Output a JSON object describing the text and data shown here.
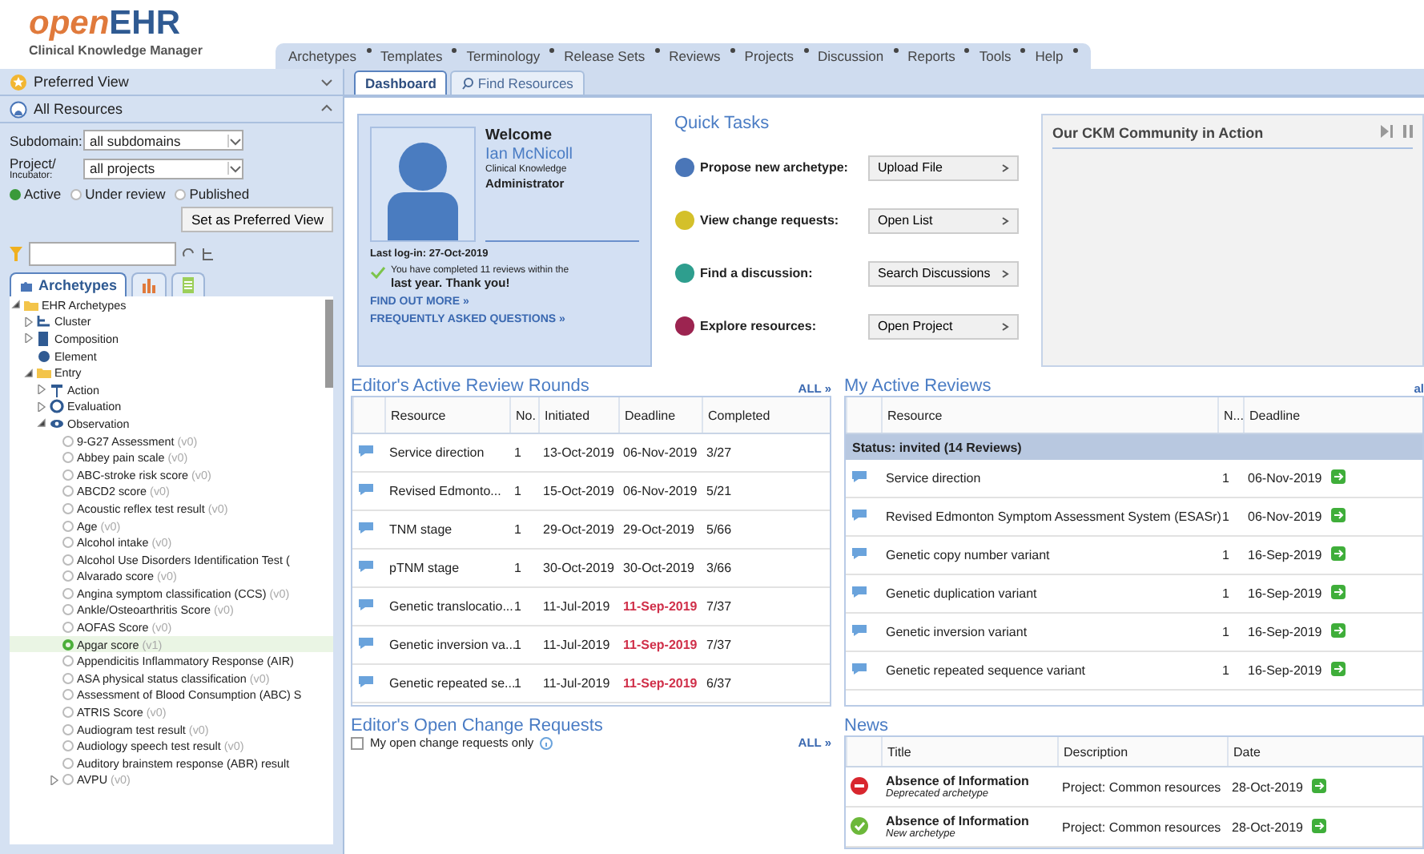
{
  "logo": {
    "brand_light": "open",
    "brand_bold": "EHR",
    "subtitle": "Clinical Knowledge Manager"
  },
  "menu": [
    {
      "label": "Archetypes"
    },
    {
      "label": "Templates"
    },
    {
      "label": "Terminology"
    },
    {
      "label": "Release Sets"
    },
    {
      "label": "Reviews"
    },
    {
      "label": "Projects"
    },
    {
      "label": "Discussion"
    },
    {
      "label": "Reports"
    },
    {
      "label": "Tools"
    },
    {
      "label": "Help"
    }
  ],
  "sidebar": {
    "preferred_view": {
      "title": "Preferred View",
      "expanded": false
    },
    "all_resources": {
      "title": "All Resources",
      "expanded": true
    },
    "subdomain": {
      "label": "Subdomain:",
      "value": "all subdomains"
    },
    "project": {
      "label": "Project/",
      "sublabel": "Incubator:",
      "value": "all projects"
    },
    "status_filter": [
      {
        "label": "Active",
        "selected": true
      },
      {
        "label": "Under review",
        "selected": false
      },
      {
        "label": "Published",
        "selected": false
      }
    ],
    "preferred_button": "Set as Preferred View",
    "tabs": [
      {
        "kind": "archetypes",
        "label": "Archetypes",
        "selected": true
      },
      {
        "kind": "templates",
        "selected": false
      },
      {
        "kind": "terminology",
        "selected": false
      }
    ],
    "tree": [
      {
        "label": "EHR Archetypes",
        "kind": "folder",
        "expanded": true,
        "children": [
          {
            "label": "Cluster",
            "kind": "cluster",
            "expanded": false
          },
          {
            "label": "Composition",
            "kind": "composition",
            "expanded": false
          },
          {
            "label": "Element",
            "kind": "element"
          },
          {
            "label": "Entry",
            "kind": "folder",
            "expanded": true,
            "children": [
              {
                "label": "Action",
                "kind": "action",
                "expanded": false
              },
              {
                "label": "Evaluation",
                "kind": "evaluation",
                "expanded": false
              },
              {
                "label": "Observation",
                "kind": "observation",
                "expanded": true,
                "children": [
                  {
                    "label": "9-G27 Assessment",
                    "version": "(v0)",
                    "kind": "archetype",
                    "selected": false
                  },
                  {
                    "label": "Abbey pain scale",
                    "version": "(v0)",
                    "kind": "archetype",
                    "selected": false
                  },
                  {
                    "label": "ABC-stroke risk score",
                    "version": "(v0)",
                    "kind": "archetype",
                    "selected": false
                  },
                  {
                    "label": "ABCD2 score",
                    "version": "(v0)",
                    "kind": "archetype",
                    "selected": false
                  },
                  {
                    "label": "Acoustic reflex test result",
                    "version": "(v0)",
                    "kind": "archetype",
                    "selected": false
                  },
                  {
                    "label": "Age",
                    "version": "(v0)",
                    "kind": "archetype",
                    "selected": false
                  },
                  {
                    "label": "Alcohol intake",
                    "version": "(v0)",
                    "kind": "archetype",
                    "selected": false
                  },
                  {
                    "label": "Alcohol Use Disorders Identification Test (",
                    "kind": "archetype",
                    "selected": false
                  },
                  {
                    "label": "Alvarado score",
                    "version": "(v0)",
                    "kind": "archetype",
                    "selected": false
                  },
                  {
                    "label": "Angina symptom classification (CCS)",
                    "version": "(v0)",
                    "kind": "archetype",
                    "selected": false
                  },
                  {
                    "label": "Ankle/Osteoarthritis Score",
                    "version": "(v0)",
                    "kind": "archetype",
                    "selected": false
                  },
                  {
                    "label": "AOFAS Score",
                    "version": "(v0)",
                    "kind": "archetype",
                    "selected": false
                  },
                  {
                    "label": "Apgar score",
                    "version": "(v1)",
                    "kind": "archetype",
                    "selected": true
                  },
                  {
                    "label": "Appendicitis Inflammatory Response (AIR)",
                    "kind": "archetype",
                    "selected": false
                  },
                  {
                    "label": "ASA physical status classification",
                    "version": "(v0)",
                    "kind": "archetype",
                    "selected": false
                  },
                  {
                    "label": "Assessment of Blood Consumption (ABC) S",
                    "kind": "archetype",
                    "selected": false
                  },
                  {
                    "label": "ATRIS Score",
                    "version": "(v0)",
                    "kind": "archetype",
                    "selected": false
                  },
                  {
                    "label": "Audiogram test result",
                    "version": "(v0)",
                    "kind": "archetype",
                    "selected": false
                  },
                  {
                    "label": "Audiology speech test result",
                    "version": "(v0)",
                    "kind": "archetype",
                    "selected": false
                  },
                  {
                    "label": "Auditory brainstem response (ABR) result",
                    "kind": "archetype",
                    "selected": false
                  },
                  {
                    "label": "AVPU",
                    "version": "(v0)",
                    "kind": "archetype",
                    "selected": false,
                    "expanded": false
                  }
                ]
              }
            ]
          }
        ]
      }
    ]
  },
  "main_tabs": [
    {
      "label": "Dashboard",
      "kind": "plain",
      "selected": true
    },
    {
      "label": "Find Resources",
      "kind": "search",
      "selected": false
    }
  ],
  "welcome": {
    "greeting": "Welcome",
    "name": "Ian McNicoll",
    "role_small": "Clinical Knowledge",
    "role": "Administrator",
    "last_login": "Last log-in: 27-Oct-2019",
    "message_small": "You have completed 11 reviews within the",
    "message": "last year. Thank you!",
    "links": [
      "FIND OUT MORE »",
      "FREQUENTLY ASKED QUESTIONS »"
    ]
  },
  "quick_tasks": {
    "title": "Quick Tasks",
    "items": [
      {
        "label": "Propose new archetype:",
        "button": "Upload File",
        "color": "#4a76b8"
      },
      {
        "label": "View change requests:",
        "button": "Open List",
        "color": "#d4c02a"
      },
      {
        "label": "Find a discussion:",
        "button": "Search Discussions",
        "color": "#2e9e8e"
      },
      {
        "label": "Explore resources:",
        "button": "Open Project",
        "color": "#9c2450"
      }
    ]
  },
  "community": {
    "title": "Our CKM Community in Action"
  },
  "review_rounds": {
    "title": "Editor's Active Review Rounds",
    "all_link": "ALL »",
    "columns": [
      "Resource",
      "No.",
      "Initiated",
      "Deadline",
      "Completed"
    ],
    "rows": [
      {
        "resource": "Service direction",
        "no": "1",
        "initiated": "13-Oct-2019",
        "deadline": "06-Nov-2019",
        "overdue": false,
        "completed": "3/27"
      },
      {
        "resource": "Revised Edmonto...",
        "no": "1",
        "initiated": "15-Oct-2019",
        "deadline": "06-Nov-2019",
        "overdue": false,
        "completed": "5/21"
      },
      {
        "resource": "TNM stage",
        "no": "1",
        "initiated": "29-Oct-2019",
        "deadline": "29-Oct-2019",
        "overdue": false,
        "completed": "5/66"
      },
      {
        "resource": "pTNM stage",
        "no": "1",
        "initiated": "30-Oct-2019",
        "deadline": "30-Oct-2019",
        "overdue": false,
        "completed": "3/66"
      },
      {
        "resource": "Genetic translocatio...",
        "no": "1",
        "initiated": "11-Jul-2019",
        "deadline": "11-Sep-2019",
        "overdue": true,
        "completed": "7/37"
      },
      {
        "resource": "Genetic inversion va...",
        "no": "1",
        "initiated": "11-Jul-2019",
        "deadline": "11-Sep-2019",
        "overdue": true,
        "completed": "7/37"
      },
      {
        "resource": "Genetic repeated se...",
        "no": "1",
        "initiated": "11-Jul-2019",
        "deadline": "11-Sep-2019",
        "overdue": true,
        "completed": "6/37"
      }
    ]
  },
  "my_reviews": {
    "title": "My Active Reviews",
    "all_link": "al",
    "columns": [
      "Resource",
      "N...",
      "Deadline"
    ],
    "group": "Status: invited (14 Reviews)",
    "rows": [
      {
        "resource": "Service direction",
        "no": "1",
        "deadline": "06-Nov-2019"
      },
      {
        "resource": "Revised Edmonton Symptom Assessment System (ESASr)",
        "no": "1",
        "deadline": "06-Nov-2019"
      },
      {
        "resource": "Genetic copy number variant",
        "no": "1",
        "deadline": "16-Sep-2019"
      },
      {
        "resource": "Genetic duplication variant",
        "no": "1",
        "deadline": "16-Sep-2019"
      },
      {
        "resource": "Genetic inversion variant",
        "no": "1",
        "deadline": "16-Sep-2019"
      },
      {
        "resource": "Genetic repeated sequence variant",
        "no": "1",
        "deadline": "16-Sep-2019"
      }
    ]
  },
  "change_requests": {
    "title": "Editor's Open Change Requests",
    "checkbox": {
      "label": "My open change requests only",
      "checked": false
    },
    "all_link": "ALL »"
  },
  "news": {
    "title": "News",
    "columns": [
      "Title",
      "Description",
      "Date"
    ],
    "rows": [
      {
        "kind": "deprecated",
        "title": "Absence of Information",
        "subtitle": "Deprecated archetype",
        "description": "Project: Common resources",
        "date": "28-Oct-2019"
      },
      {
        "kind": "new",
        "title": "Absence of Information",
        "subtitle": "New archetype",
        "description": "Project: Common resources",
        "date": "28-Oct-2019"
      }
    ]
  }
}
